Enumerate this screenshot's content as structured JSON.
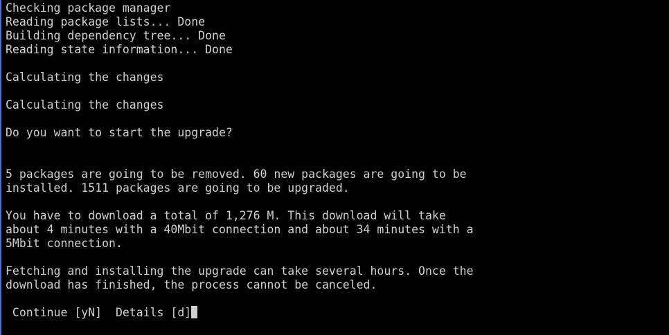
{
  "terminal": {
    "lines": [
      "Checking package manager",
      "Reading package lists... Done",
      "Building dependency tree... Done",
      "Reading state information... Done",
      "",
      "Calculating the changes",
      "",
      "Calculating the changes",
      "",
      "Do you want to start the upgrade?",
      "",
      "",
      "5 packages are going to be removed. 60 new packages are going to be",
      "installed. 1511 packages are going to be upgraded.",
      "",
      "You have to download a total of 1,276 M. This download will take",
      "about 4 minutes with a 40Mbit connection and about 34 minutes with a",
      "5Mbit connection.",
      "",
      "Fetching and installing the upgrade can take several hours. Once the",
      "download has finished, the process cannot be canceled.",
      ""
    ],
    "prompt": " Continue [yN]  Details [d]"
  },
  "colors": {
    "background": "#000000",
    "foreground": "#d0d0d0",
    "left_border": "#4a6ee0"
  }
}
